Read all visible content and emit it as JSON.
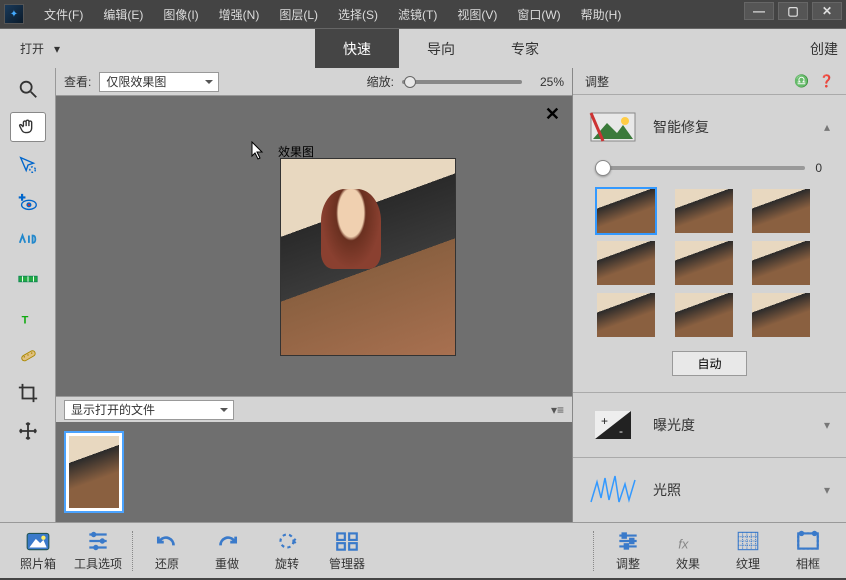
{
  "menu": {
    "file": "文件(F)",
    "edit": "编辑(E)",
    "image": "图像(I)",
    "enhance": "增强(N)",
    "layer": "图层(L)",
    "select": "选择(S)",
    "filter": "滤镜(T)",
    "view": "视图(V)",
    "window": "窗口(W)",
    "help": "帮助(H)"
  },
  "toolbar": {
    "open": "打开",
    "tab_quick": "快速",
    "tab_guided": "导向",
    "tab_expert": "专家",
    "tab_create": "创建"
  },
  "ws": {
    "view_label": "查看:",
    "view_value": "仅限效果图",
    "zoom_label": "缩放:",
    "zoom_value": "25%",
    "canvas_title": "效果图",
    "filmstrip_label": "显示打开的文件"
  },
  "panel": {
    "header": "调整",
    "smart": "智能修复",
    "smart_value": "0",
    "auto": "自动",
    "exposure": "曝光度",
    "lighting": "光照"
  },
  "bottom": {
    "photobin": "照片箱",
    "tooloptions": "工具选项",
    "undo": "还原",
    "redo": "重做",
    "rotate": "旋转",
    "organizer": "管理器",
    "adjust": "调整",
    "effects": "效果",
    "texture": "纹理",
    "frame": "相框"
  }
}
